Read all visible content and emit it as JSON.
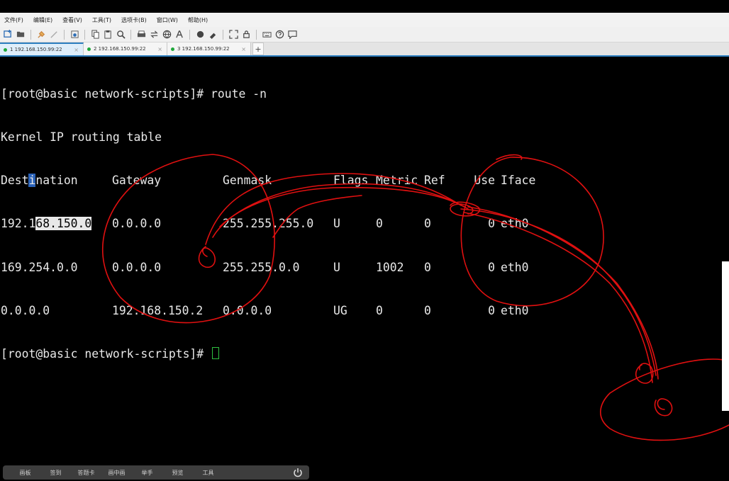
{
  "menu": [
    "文件(F)",
    "编辑(E)",
    "查看(V)",
    "工具(T)",
    "选项卡(B)",
    "窗口(W)",
    "帮助(H)"
  ],
  "tabs": [
    {
      "label": "1 192.168.150.99:22",
      "active": true
    },
    {
      "label": "2 192.168.150.99:22",
      "active": false
    },
    {
      "label": "3 192.168.150.99:22",
      "active": false
    }
  ],
  "tab_add": "+",
  "tab_close": "×",
  "terminal": {
    "prompt_cmd": "[root@basic network-scripts]# route -n",
    "title": "Kernel IP routing table",
    "headers": [
      "Destination",
      "Gateway",
      "Genmask",
      "Flags",
      "Metric",
      "Ref",
      "Use",
      "Iface"
    ],
    "rows": [
      [
        "192.168.150.0",
        "0.0.0.0",
        "255.255.255.0",
        "U",
        "0",
        "0",
        "0",
        "eth0"
      ],
      [
        "169.254.0.0",
        "0.0.0.0",
        "255.255.0.0",
        "U",
        "1002",
        "0",
        "0",
        "eth0"
      ],
      [
        "0.0.0.0",
        "192.168.150.2",
        "0.0.0.0",
        "UG",
        "0",
        "0",
        "0",
        "eth0"
      ]
    ],
    "prompt": "[root@basic network-scripts]# "
  },
  "bottom_bar": [
    "画板",
    "签到",
    "答题卡",
    "画中画",
    "举手",
    "预览",
    "工具"
  ],
  "colors": {
    "annotation": "#e01010",
    "tab_accent": "#2d7fc0",
    "cursor": "#2fbf40"
  }
}
